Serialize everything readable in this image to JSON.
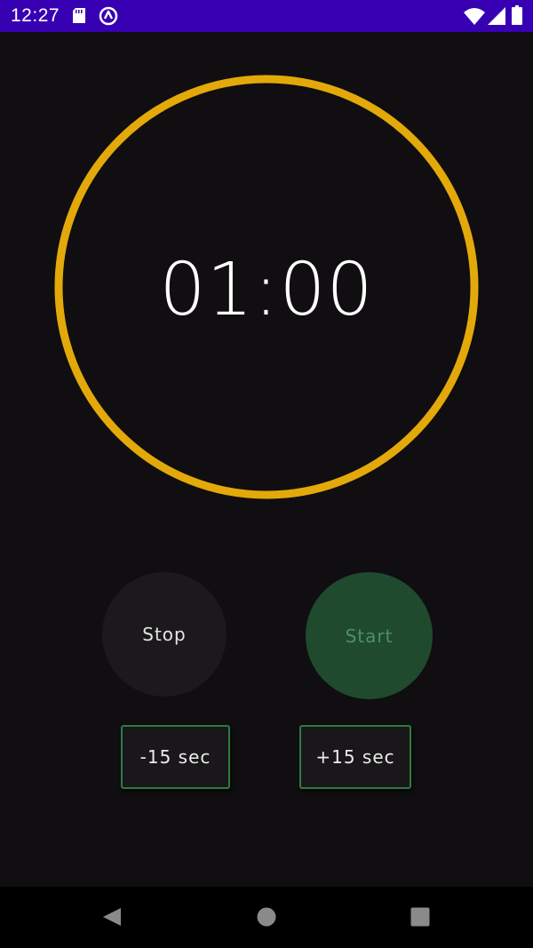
{
  "status_bar": {
    "time": "12:27",
    "icons": [
      "sd-card-icon",
      "sync-icon",
      "wifi-icon",
      "signal-icon",
      "battery-icon"
    ],
    "background_color": "#3700b3"
  },
  "timer": {
    "display": "01:00",
    "ring_color": "#e3a90a",
    "progress": 1.0
  },
  "controls": {
    "stop_label": "Stop",
    "start_label": "Start",
    "minus_label": "-15 sec",
    "plus_label": "+15 sec",
    "stop_color": "#1b191b",
    "start_color": "#1f4a2e",
    "adjust_border_color": "#2f7a45"
  },
  "nav_bar": {
    "icons": [
      "back-icon",
      "home-icon",
      "recents-icon"
    ]
  }
}
